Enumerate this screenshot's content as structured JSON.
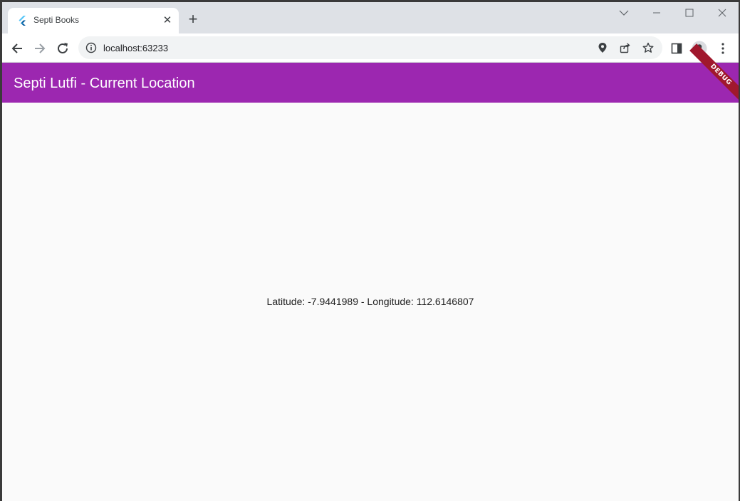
{
  "browser": {
    "tab": {
      "title": "Septi Books",
      "close_label": "✕"
    },
    "new_tab_label": "+",
    "address": {
      "url": "localhost:63233"
    }
  },
  "app": {
    "title": "Septi Lutfi - Current Location",
    "debug_banner": "DEBUG",
    "location_text": "Latitude: -7.9441989 - Longitude: 112.6146807",
    "colors": {
      "appbar": "#9c27b0",
      "debug_banner": "#a0182d",
      "background": "#fafafa"
    }
  },
  "icons": {
    "favicon": "flutter-icon",
    "back": "arrow-left-icon",
    "forward": "arrow-right-icon",
    "reload": "reload-icon",
    "info": "info-icon",
    "location": "location-pin-icon",
    "share": "share-icon",
    "bookmark": "star-icon",
    "side_panel": "side-panel-icon",
    "profile": "profile-icon",
    "menu": "kebab-menu-icon"
  }
}
